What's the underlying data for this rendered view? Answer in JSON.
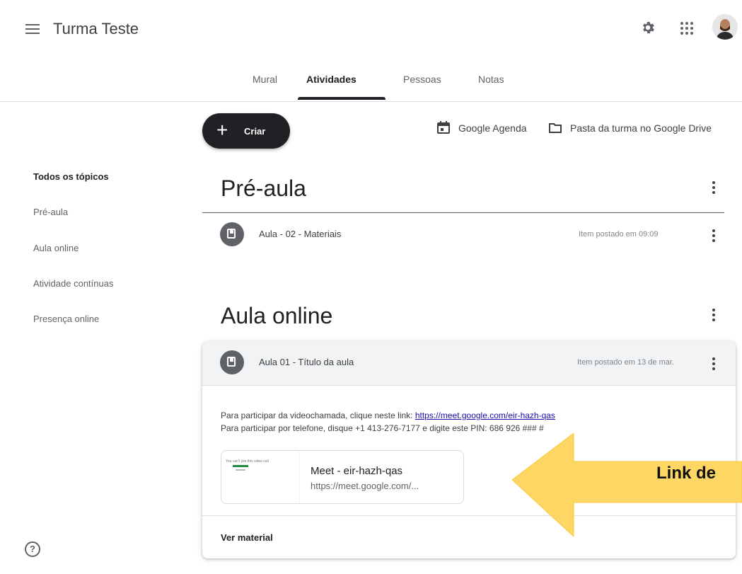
{
  "header": {
    "title": "Turma Teste"
  },
  "tabs": [
    {
      "label": "Mural"
    },
    {
      "label": "Atividades"
    },
    {
      "label": "Pessoas"
    },
    {
      "label": "Notas"
    }
  ],
  "toolbar": {
    "create_label": "Criar",
    "calendar_label": "Google Agenda",
    "drive_label": "Pasta da turma no Google Drive"
  },
  "sidebar": {
    "items": [
      {
        "label": "Todos os tópicos"
      },
      {
        "label": "Pré-aula"
      },
      {
        "label": "Aula online"
      },
      {
        "label": "Atividade contínuas"
      },
      {
        "label": "Presença online"
      }
    ]
  },
  "topics": [
    {
      "title": "Pré-aula",
      "items": [
        {
          "title": "Aula - 02 - Materiais",
          "posted": "Item postado em 09:09"
        }
      ]
    },
    {
      "title": "Aula online",
      "items": [
        {
          "title": "Aula 01 - Título da aula",
          "posted": "Item postado em 13 de mar.",
          "description_line1_prefix": "Para participar da videochamada, clique neste link: ",
          "description_link": "https://meet.google.com/eir-hazh-qas",
          "description_line2": "Para participar por telefone, disque +1 413-276-7177 e digite este PIN: 686 926 ### #",
          "attachment_title": "Meet - eir-hazh-qas",
          "attachment_url": "https://meet.google.com/...",
          "attachment_thumb_text": "You can't join this video call",
          "view_material": "Ver material"
        }
      ]
    }
  ],
  "callout": {
    "label": "Link de",
    "color": "#fdd663"
  },
  "icons": [
    "menu-icon",
    "gear-icon",
    "apps-icon",
    "avatar",
    "calendar-icon",
    "folder-icon",
    "material-icon",
    "more-vert-icon",
    "help-icon",
    "arrow"
  ]
}
